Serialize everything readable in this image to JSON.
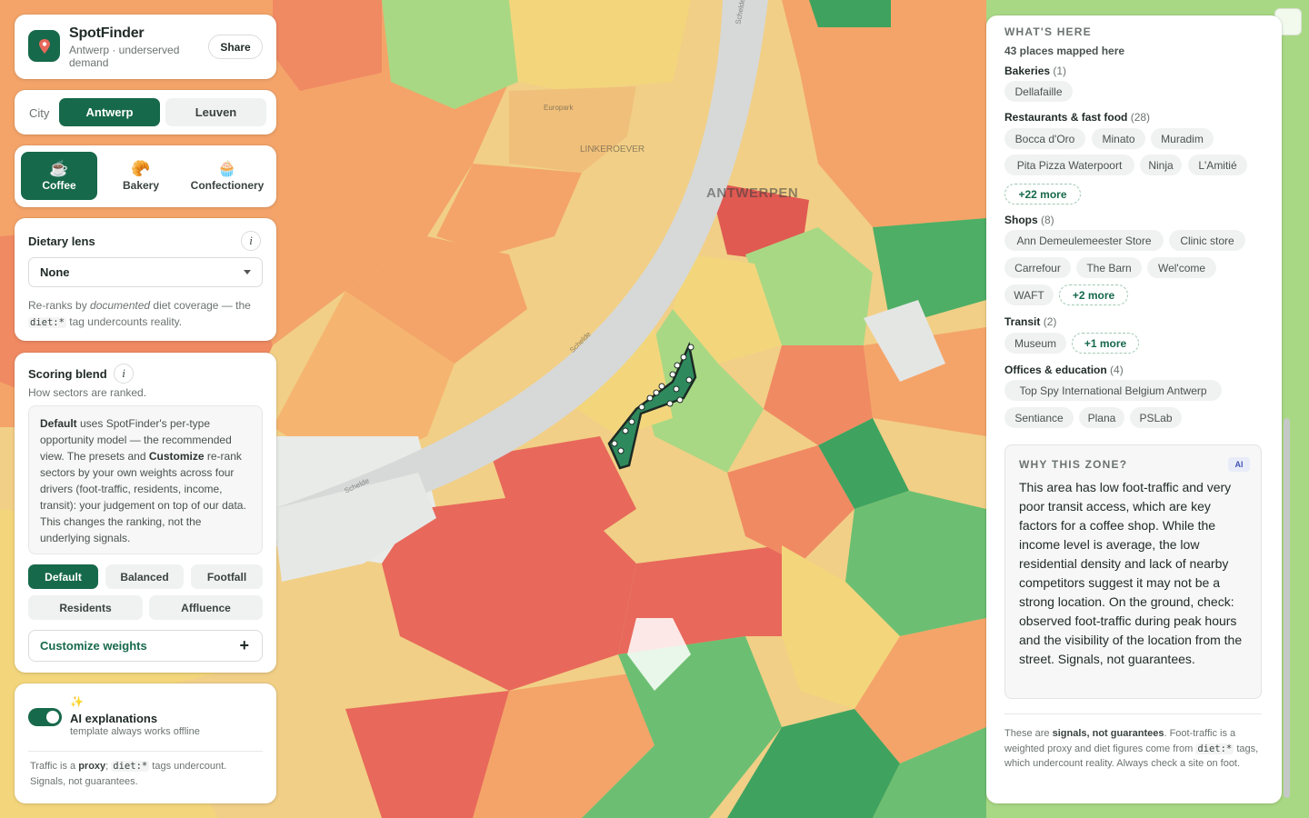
{
  "app": {
    "title": "SpotFinder",
    "subtitle": "Antwerp · underserved demand",
    "share_label": "Share"
  },
  "city": {
    "label": "City",
    "options": [
      "Antwerp",
      "Leuven"
    ],
    "selected": "Antwerp"
  },
  "business_types": [
    {
      "label": "Coffee",
      "icon": "☕",
      "icon_name": "coffee-icon",
      "selected": true
    },
    {
      "label": "Bakery",
      "icon": "🥐",
      "icon_name": "croissant-icon",
      "selected": false
    },
    {
      "label": "Confectionery",
      "icon": "🧁",
      "icon_name": "cupcake-icon",
      "selected": false
    }
  ],
  "dietary": {
    "title": "Dietary lens",
    "selected": "None",
    "help_pre": "Re-ranks by ",
    "help_em": "documented",
    "help_mid": " diet coverage — the ",
    "help_code": "diet:*",
    "help_post": " tag undercounts reality."
  },
  "scoring": {
    "title": "Scoring blend",
    "subtitle": "How sectors are ranked.",
    "desc_b1": "Default",
    "desc_t1": " uses SpotFinder's per-type opportunity model — the recommended view. The presets and ",
    "desc_b2": "Customize",
    "desc_t2": " re-rank sectors by your own weights across four drivers (foot-traffic, residents, income, transit): your judgement on top of our data. This changes the ranking, not the underlying signals.",
    "presets": [
      "Default",
      "Balanced",
      "Footfall",
      "Residents",
      "Affluence"
    ],
    "selected_preset": "Default",
    "customize_label": "Customize weights"
  },
  "ai": {
    "title": "AI explanations",
    "subtitle": "template always works offline",
    "enabled": true
  },
  "footer_note": {
    "t1": "Traffic is a ",
    "b1": "proxy",
    "t2": "; ",
    "code": "diet:*",
    "t3": " tags undercount. Signals, not guarantees."
  },
  "whats_here": {
    "title": "WHAT'S HERE",
    "count_text": "43 places mapped here",
    "groups": [
      {
        "name": "Bakeries",
        "count": "(1)",
        "chips": [
          "Dellafaille"
        ],
        "more": null
      },
      {
        "name": "Restaurants & fast food",
        "count": "(28)",
        "chips": [
          "Bocca d'Oro",
          "Minato",
          "Muradim",
          "Pita Pizza Waterpoort",
          "Ninja",
          "L'Amitié"
        ],
        "more": "+22 more"
      },
      {
        "name": "Shops",
        "count": "(8)",
        "chips": [
          "Ann Demeulemeester Store",
          "Clinic store",
          "Carrefour",
          "The Barn",
          "Wel'come",
          "WAFT"
        ],
        "more": "+2 more"
      },
      {
        "name": "Transit",
        "count": "(2)",
        "chips": [
          "Museum"
        ],
        "more": "+1 more"
      },
      {
        "name": "Offices & education",
        "count": "(4)",
        "chips": [
          "Top Spy International Belgium Antwerp",
          "Sentiance",
          "Plana",
          "PSLab"
        ],
        "more": null
      }
    ]
  },
  "why_zone": {
    "title": "WHY THIS ZONE?",
    "badge": "AI",
    "text": "This area has low foot-traffic and very poor transit access, which are key factors for a coffee shop. While the income level is average, the low residential density and lack of nearby competitors suggest it may not be a strong location. On the ground, check: observed foot-traffic during peak hours and the visibility of the location from the street. Signals, not guarantees."
  },
  "panel_note": {
    "t1": "These are ",
    "b1": "signals, not guarantees",
    "t2": ". Foot-traffic is a weighted proxy and diet figures come from ",
    "code": "diet:*",
    "t3": " tags, which undercount reality. Always check a site on foot."
  },
  "map": {
    "labels": {
      "antwerpen": "ANTWERPEN",
      "linkeroever": "LINKEROEVER",
      "europark": "Europark",
      "schelde_1": "Schelde",
      "schelde_2": "Schelde",
      "schelde_3": "Schelde"
    },
    "colors": {
      "high": "#6cbf72",
      "mid_high": "#a9d884",
      "mid": "#f3d67c",
      "mid_low": "#f4a469",
      "low": "#ec6d5e",
      "selected": "#2e8a5d"
    }
  }
}
